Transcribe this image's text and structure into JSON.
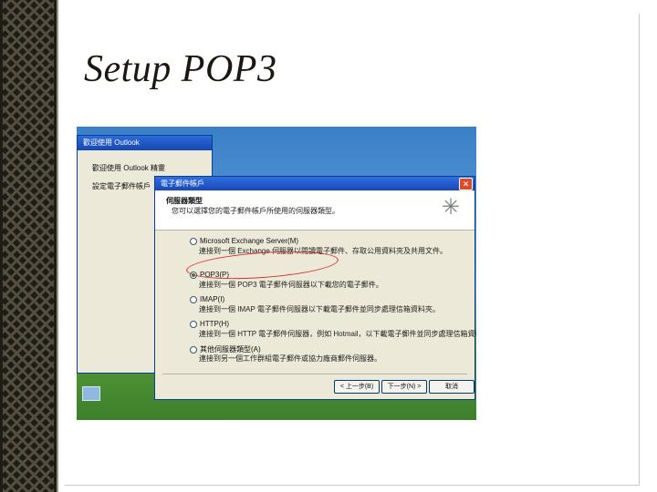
{
  "slide": {
    "title": "Setup POP3"
  },
  "outlook_window": {
    "title": "歡迎使用 Outlook",
    "line1": "歡迎使用 Outlook 精靈",
    "line2": "設定電子郵件帳戶"
  },
  "dialog": {
    "title": "電子郵件帳戶",
    "header_title": "伺服器類型",
    "header_subtitle": "您可以選擇您的電子郵件帳戶所使用的伺服器類型。",
    "options": [
      {
        "label": "Microsoft Exchange Server(M)",
        "desc": "連接到一個 Exchange 伺服器以閱讀電子郵件、存取公用資料夾及共用文件。",
        "selected": false
      },
      {
        "label": "POP3(P)",
        "desc": "連接到一個 POP3 電子郵件伺服器以下載您的電子郵件。",
        "selected": true
      },
      {
        "label": "IMAP(I)",
        "desc": "連接到一個 IMAP 電子郵件伺服器以下載電子郵件並同步處理信箱資料夾。",
        "selected": false
      },
      {
        "label": "HTTP(H)",
        "desc": "連接到一個 HTTP 電子郵件伺服器，例如 Hotmail，以下載電子郵件並同步處理信箱資料夾。",
        "selected": false
      },
      {
        "label": "其他伺服器類型(A)",
        "desc": "連接到另一個工作群組電子郵件或協力廠商郵件伺服器。",
        "selected": false
      }
    ],
    "buttons": {
      "back": "< 上一步(B)",
      "next": "下一步(N) >",
      "cancel": "取消"
    }
  },
  "icons": {
    "close": "close-icon",
    "wizard": "mail-wizard-icon"
  },
  "colors": {
    "title_text": "#1c1810",
    "xp_titlebar": "#1848b8",
    "highlight_ellipse": "#d23030"
  }
}
